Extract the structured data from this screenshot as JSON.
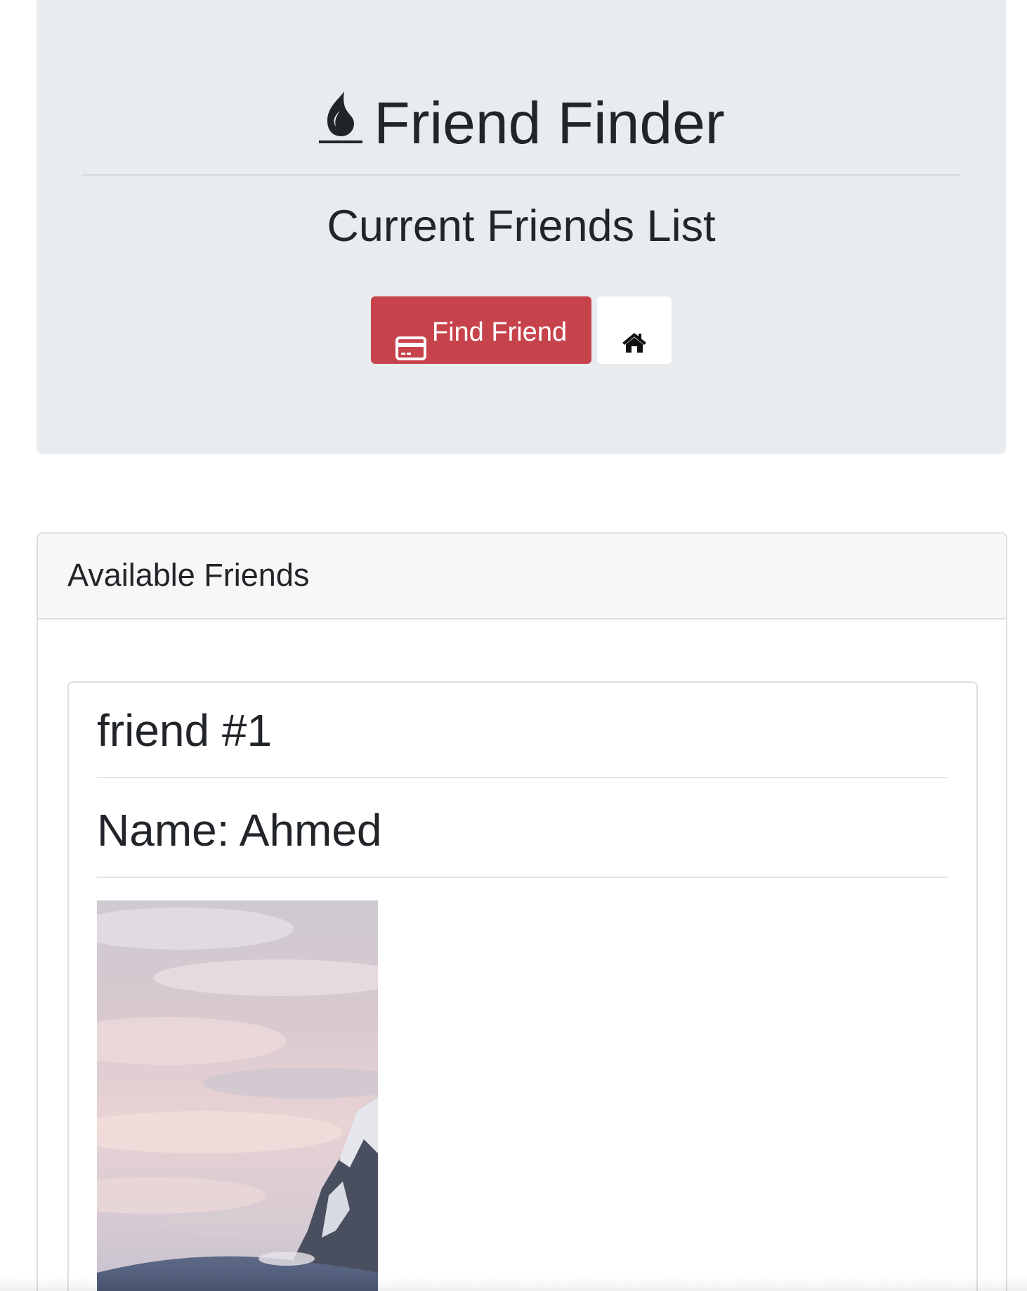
{
  "header": {
    "logo_icon": "flame-icon",
    "app_title": "Friend Finder",
    "page_subtitle": "Current Friends List",
    "find_friend_button": {
      "label": "Find Friend",
      "icon": "credit-card-icon",
      "color": "#c7434c"
    },
    "home_button": {
      "icon": "home-icon"
    }
  },
  "friends_panel": {
    "title": "Available Friends",
    "friends": [
      {
        "number_label": "friend #1",
        "name_label": "Name: Ahmed",
        "photo": "mountain-landscape-photo"
      }
    ]
  },
  "colors": {
    "header_background": "#e9ecef",
    "danger": "#c7434c",
    "text": "#212529"
  }
}
